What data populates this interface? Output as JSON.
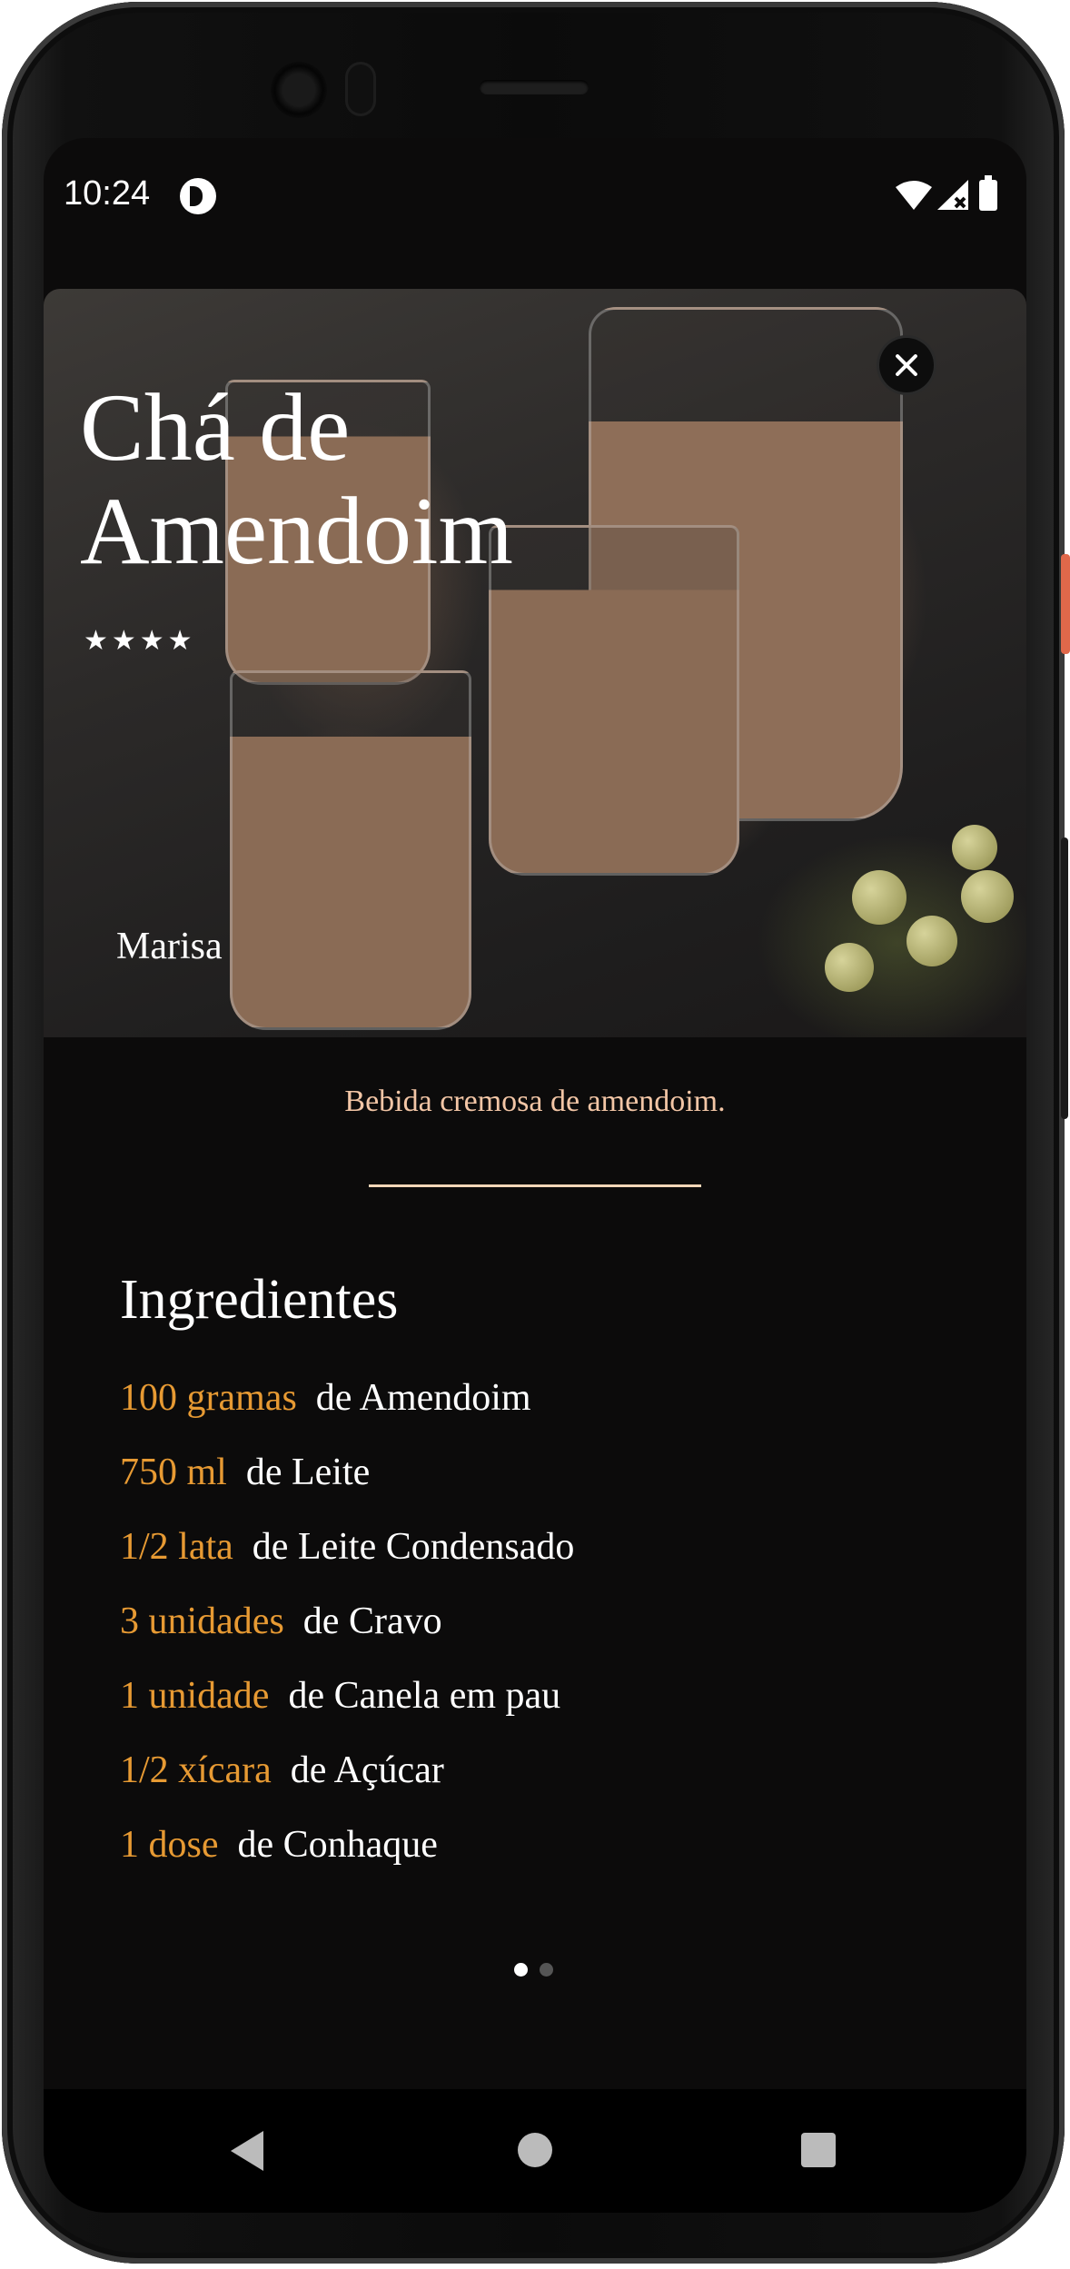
{
  "status_bar": {
    "time": "10:24",
    "icons": [
      "app-notification-icon",
      "wifi-icon",
      "signal-icon",
      "battery-icon"
    ]
  },
  "recipe": {
    "title_line1": "Chá de",
    "title_line2": "Amendoim",
    "rating": 4,
    "stars": "★★★★",
    "author": "Marisa",
    "description": "Bebida cremosa de amendoim."
  },
  "ingredients": {
    "heading": "Ingredientes",
    "items": [
      {
        "quantity": "100 gramas",
        "name": "de Amendoim"
      },
      {
        "quantity": "750 ml",
        "name": "de Leite"
      },
      {
        "quantity": "1/2 lata",
        "name": "de Leite Condensado"
      },
      {
        "quantity": "3 unidades",
        "name": "de Cravo"
      },
      {
        "quantity": "1 unidade",
        "name": "de Canela em pau"
      },
      {
        "quantity": "1/2 xícara",
        "name": "de Açúcar"
      },
      {
        "quantity": "1 dose",
        "name": "de Conhaque"
      }
    ]
  },
  "pager": {
    "current": 1,
    "total": 2
  },
  "nav": {
    "icons": [
      "back-icon",
      "home-icon",
      "recents-icon"
    ]
  },
  "colors": {
    "background": "#0c0b0b",
    "accent_quantity": "#e79a33",
    "description": "#f3c6a6",
    "text": "#ffffff"
  }
}
